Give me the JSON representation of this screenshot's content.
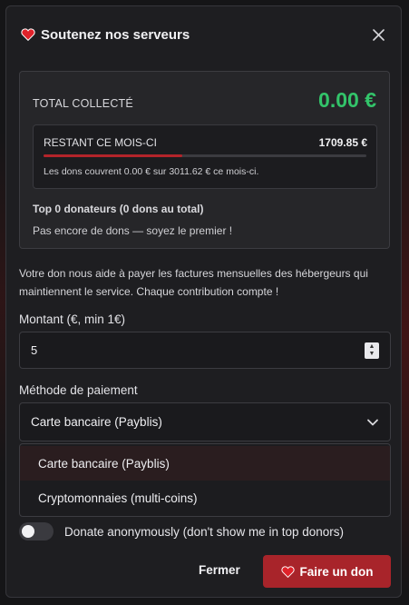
{
  "colors": {
    "accent_red": "#a8242a",
    "total_green": "#33c46a",
    "progress_red": "#b3242a"
  },
  "header": {
    "title": "Soutenez nos serveurs",
    "icon": "heart-icon",
    "close_icon": "close-icon"
  },
  "stats": {
    "total_label": "TOTAL COLLECTÉ",
    "total_value": "0.00 €",
    "remaining_label": "RESTANT CE MOIS-CI",
    "remaining_value": "1709.85 €",
    "progress_percent": 43,
    "description": "Les dons couvrent 0.00 € sur 3011.62 € ce mois-ci.",
    "top_donors": "Top 0 donateurs (0 dons au total)",
    "no_donors": "Pas encore de dons — soyez le premier !"
  },
  "info_text": "Votre don nous aide à payer les factures mensuelles des hébergeurs qui maintiennent le service. Chaque contribution compte !",
  "amount": {
    "label": "Montant (€, min 1€)",
    "value": "5"
  },
  "payment": {
    "label": "Méthode de paiement",
    "selected": "Carte bancaire (Payblis)",
    "options": [
      "Carte bancaire (Payblis)",
      "Cryptomonnaies (multi-coins)"
    ]
  },
  "anonymous": {
    "label": "Donate anonymously (don't show me in top donors)",
    "enabled": false
  },
  "buttons": {
    "close": "Fermer",
    "donate": "Faire un don"
  }
}
